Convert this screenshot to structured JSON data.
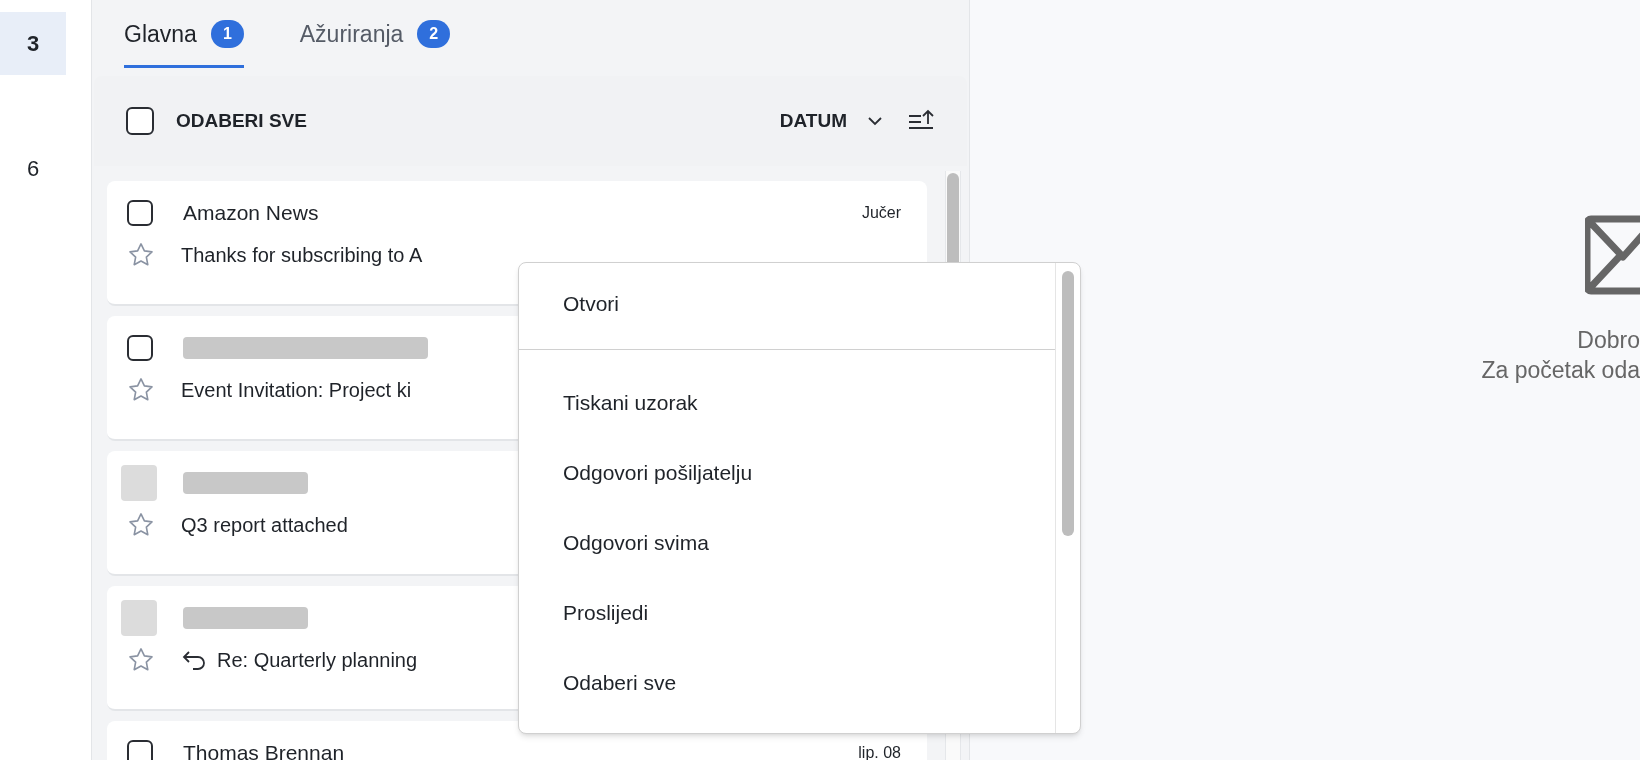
{
  "sidebar": {
    "items": [
      {
        "label": "3",
        "selected": true
      },
      {
        "label": "6",
        "selected": false
      }
    ]
  },
  "tabs": [
    {
      "label": "Glavna",
      "badge": "1",
      "selected": true
    },
    {
      "label": "Ažuriranja",
      "badge": "2",
      "selected": false
    }
  ],
  "toolbar": {
    "select_all": {
      "label": "ODABERI SVE",
      "checked": false
    },
    "sort": {
      "label": "DATUM"
    }
  },
  "messages": [
    {
      "kind": "checkbox",
      "checked": false,
      "sender": "Amazon News",
      "sender_hidden": false,
      "date": "Jučer",
      "subject": "Thanks for subscribing to A",
      "starred": false,
      "replied": false
    },
    {
      "kind": "checkbox",
      "checked": false,
      "sender_hidden": true,
      "subject": "Event Invitation: Project ki",
      "starred": false,
      "replied": false
    },
    {
      "kind": "avatar",
      "sender_hidden": true,
      "subject": "Q3 report attached",
      "starred": false,
      "replied": false
    },
    {
      "kind": "avatar",
      "sender_hidden": true,
      "subject": "Re: Quarterly planning",
      "starred": false,
      "replied": true
    },
    {
      "kind": "checkbox",
      "checked": false,
      "sender": "Thomas Brennan",
      "sender_hidden": false,
      "date": "lip. 08"
    }
  ],
  "context_menu": {
    "items": [
      {
        "label": "Otvori",
        "separator_after": true
      },
      {
        "label": "Tiskani uzorak",
        "separator_after": false
      },
      {
        "label": "Odgovori pošiljatelju",
        "separator_after": false
      },
      {
        "label": "Odgovori svima",
        "separator_after": false
      },
      {
        "label": "Proslijedi",
        "separator_after": false
      },
      {
        "label": "Odaberi sve",
        "separator_after": false
      }
    ]
  },
  "empty_state": {
    "title": "Dobro",
    "subtitle": "Za početak oda"
  }
}
